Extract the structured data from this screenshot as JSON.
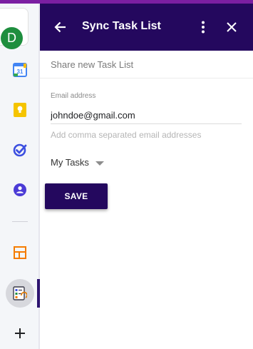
{
  "sidebar": {
    "avatar_initial": "D",
    "calendar_day": "31",
    "apps": [
      {
        "icon": "calendar-icon"
      },
      {
        "icon": "keep-icon"
      },
      {
        "icon": "tasks-icon"
      },
      {
        "icon": "contacts-icon"
      },
      {
        "icon": "layout-icon"
      },
      {
        "icon": "sync-tasks-icon"
      },
      {
        "icon": "add-icon"
      }
    ]
  },
  "header": {
    "title": "Sync Task List"
  },
  "form": {
    "share_title": "Share new Task List",
    "email_label": "Email address",
    "email_value": "johndoe@gmail.com",
    "email_hint": "Add comma separated email addresses",
    "task_list": "My Tasks",
    "save_label": "SAVE"
  },
  "colors": {
    "header_bg": "#24085e",
    "accent_strip": "#7b1fa2",
    "avatar_bg": "#1e8e3e",
    "tasks_icon": "#3c4fe0",
    "contacts_icon": "#4b3bd6",
    "keep_icon": "#f5c400"
  }
}
